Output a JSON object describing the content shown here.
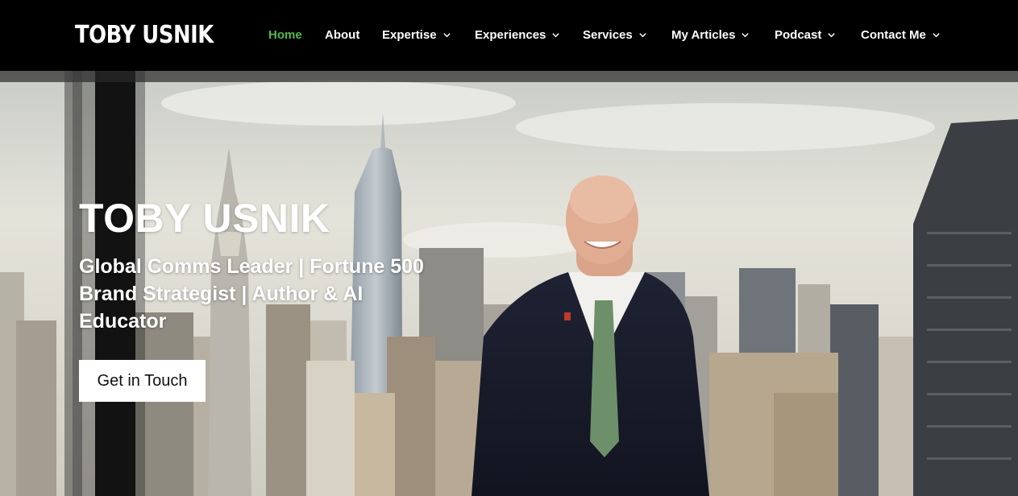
{
  "header": {
    "logo_text": "TOBY USNIK",
    "nav": [
      {
        "label": "Home",
        "active": true,
        "dropdown": false
      },
      {
        "label": "About",
        "active": false,
        "dropdown": false
      },
      {
        "label": "Expertise",
        "active": false,
        "dropdown": true
      },
      {
        "label": "Experiences",
        "active": false,
        "dropdown": true
      },
      {
        "label": "Services",
        "active": false,
        "dropdown": true
      },
      {
        "label": "My Articles",
        "active": false,
        "dropdown": true
      },
      {
        "label": "Podcast",
        "active": false,
        "dropdown": true
      },
      {
        "label": "Contact Me",
        "active": false,
        "dropdown": true
      }
    ]
  },
  "hero": {
    "title": "TOBY USNIK",
    "subtitle": "Global Comms Leader | Fortune 500 Brand Strategist | Author & AI Educator",
    "cta_label": "Get in Touch",
    "image": "city-skyline-portrait"
  },
  "colors": {
    "header_bg": "#000000",
    "active_nav": "#52b94a",
    "text": "#ffffff",
    "cta_bg": "#ffffff",
    "cta_text": "#111111"
  },
  "icons": {
    "dropdown": "chevron-down-icon"
  }
}
